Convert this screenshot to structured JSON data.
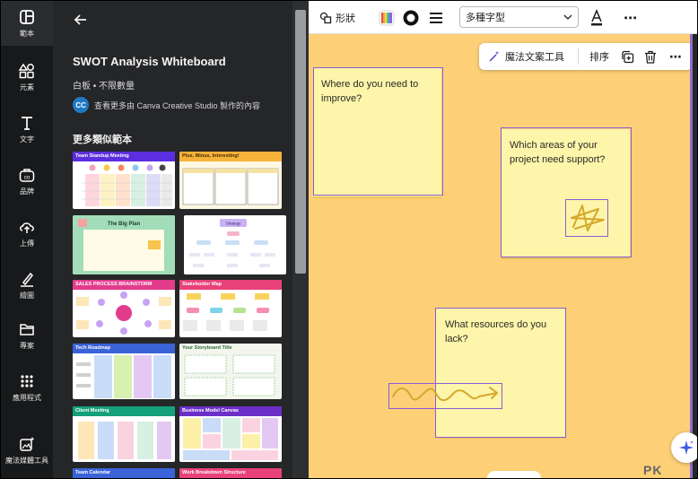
{
  "rail": {
    "items": [
      {
        "label": "範本",
        "icon": "template-icon"
      },
      {
        "label": "元素",
        "icon": "elements-icon"
      },
      {
        "label": "文字",
        "icon": "text-icon"
      },
      {
        "label": "品牌",
        "icon": "brand-icon"
      },
      {
        "label": "上傳",
        "icon": "upload-icon"
      },
      {
        "label": "繪圖",
        "icon": "draw-icon"
      },
      {
        "label": "專案",
        "icon": "folder-icon"
      },
      {
        "label": "應用程式",
        "icon": "apps-icon"
      },
      {
        "label": "魔法媒體工具",
        "icon": "magic-media-icon"
      }
    ]
  },
  "panel": {
    "title": "SWOT Analysis Whiteboard",
    "subtitle": "白板 • 不限數量",
    "creator_initials": "CC",
    "creator_text": "查看更多由 Canva Creative Studio 製作的內容",
    "section_title": "更多類似範本",
    "templates": [
      {
        "title": "Team Standup Meeting",
        "color": "#5b2ee0"
      },
      {
        "title": "Plus, Minus, Interesting!",
        "color": "#f6b33a"
      },
      {
        "title": "The Big Plan",
        "color": "#2fb56c"
      },
      {
        "title": "Strategy",
        "color": "#ffffff"
      },
      {
        "title": "SALES PROCESS BRAINSTORM",
        "color": "#e33b8c"
      },
      {
        "title": "Stakeholder Map",
        "color": "#e9417a"
      },
      {
        "title": "Tech Roadmap",
        "color": "#3a63d8"
      },
      {
        "title": "Your Storyboard Title",
        "color": "#ffffff"
      },
      {
        "title": "Client Meeting",
        "color": "#14a07a"
      },
      {
        "title": "Business Model Canvas",
        "color": "#6b2fc8"
      },
      {
        "title": "Team Calendar",
        "color": "#3a63d8"
      },
      {
        "title": "Work Breakdown Structure",
        "color": "#e9417a"
      }
    ]
  },
  "toolbar": {
    "shapes_label": "形狀",
    "font_name": "多種字型",
    "more": "⋯"
  },
  "floatbar": {
    "magic_text_label": "魔法文案工具",
    "arrange_label": "排序"
  },
  "canvas": {
    "notes": [
      {
        "text": "Where do you need to improve?"
      },
      {
        "text": "Which areas of your project need support?"
      },
      {
        "text": "What resources do you lack?"
      }
    ],
    "watermark": "PK"
  },
  "colors": {
    "canvas_bg": "#fdd077",
    "note_bg": "#fdf5a9",
    "selection": "#8b5cd6",
    "doodle": "#d4a82a"
  }
}
